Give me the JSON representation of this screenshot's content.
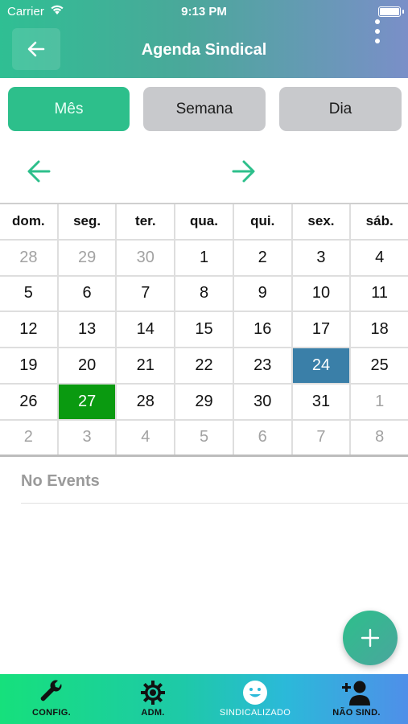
{
  "status_bar": {
    "carrier": "Carrier",
    "time": "9:13 PM"
  },
  "header": {
    "title": "Agenda Sindical",
    "back_icon": "arrow-left-icon",
    "menu_icon": "more-vertical-icon"
  },
  "segments": [
    {
      "label": "Mês",
      "active": true
    },
    {
      "label": "Semana",
      "active": false
    },
    {
      "label": "Dia",
      "active": false
    }
  ],
  "calendar": {
    "weekdays": [
      "dom.",
      "seg.",
      "ter.",
      "qua.",
      "qui.",
      "sex.",
      "sáb."
    ],
    "weeks": [
      [
        "28",
        "29",
        "30",
        "1",
        "2",
        "3",
        "4"
      ],
      [
        "5",
        "6",
        "7",
        "8",
        "9",
        "10",
        "11"
      ],
      [
        "12",
        "13",
        "14",
        "15",
        "16",
        "17",
        "18"
      ],
      [
        "19",
        "20",
        "21",
        "22",
        "23",
        "24",
        "25"
      ],
      [
        "26",
        "27",
        "28",
        "29",
        "30",
        "31",
        "1"
      ],
      [
        "2",
        "3",
        "4",
        "5",
        "6",
        "7",
        "8"
      ]
    ],
    "today": "27",
    "selected": "24",
    "today_color": "#0a9a10",
    "selected_color": "#3a7fa8"
  },
  "events": {
    "empty_text": "No Events"
  },
  "fab": {
    "icon": "plus-icon"
  },
  "tabbar": {
    "items": [
      {
        "label": "CONFIG.",
        "icon": "wrench-icon"
      },
      {
        "label": "ADM.",
        "icon": "gear-icon"
      },
      {
        "label": "SINDICALIZADO",
        "icon": "smile-icon",
        "active": true
      },
      {
        "label": "NÃO SIND.",
        "icon": "add-user-icon"
      }
    ]
  },
  "colors": {
    "accent": "#2dbf8b",
    "inactive_segment": "#c8c9cc"
  }
}
